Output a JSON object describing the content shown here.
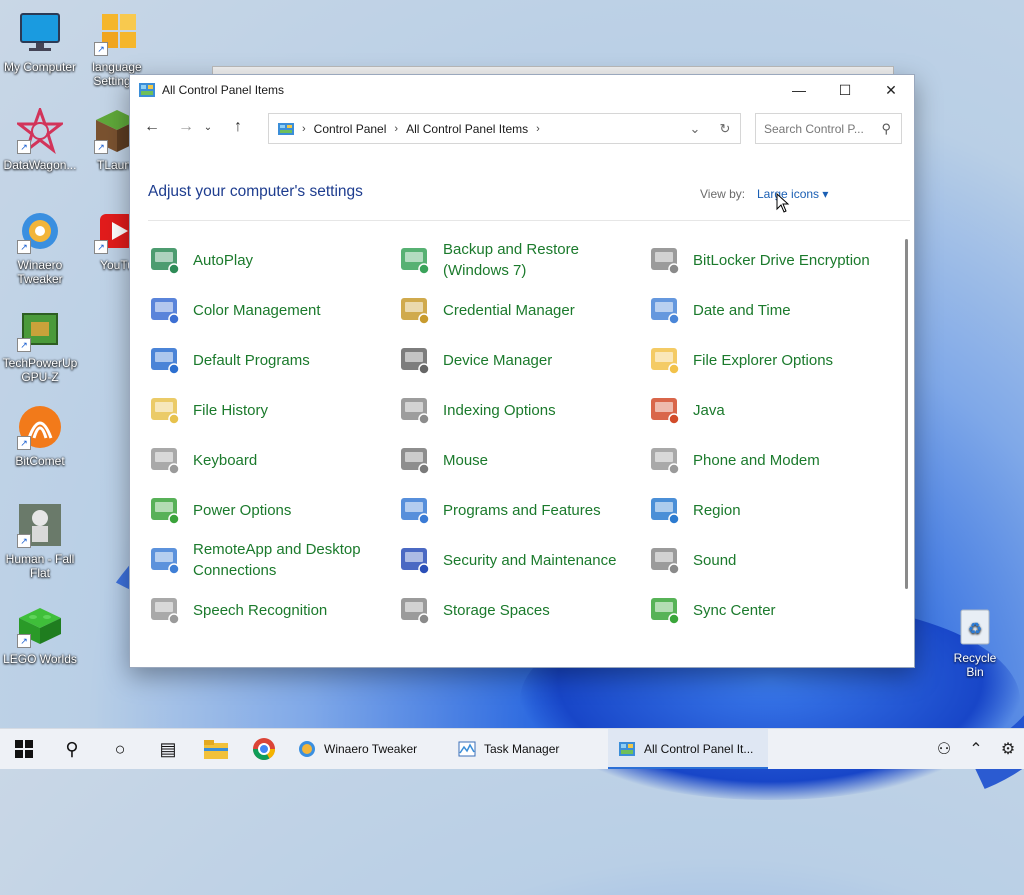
{
  "desktop": {
    "icons": [
      {
        "label": "My Computer"
      },
      {
        "label": "language Setting L"
      },
      {
        "label": "DataWagon..."
      },
      {
        "label": "TLaunc"
      },
      {
        "label": "Winaero Tweaker"
      },
      {
        "label": "YouTu"
      },
      {
        "label": "TechPowerUp GPU-Z"
      },
      {
        "label": "BitComet"
      },
      {
        "label": "Human - Fall Flat"
      },
      {
        "label": "LEGO Worlds"
      }
    ],
    "recycle_bin": "Recycle Bin"
  },
  "window": {
    "title": "All Control Panel Items",
    "controls": {
      "minimize": "—",
      "maximize": "☐",
      "close": "✕"
    },
    "address": {
      "crumbs": [
        "Control Panel",
        "All Control Panel Items"
      ]
    },
    "search": {
      "placeholder": "Search Control P..."
    },
    "heading": "Adjust your computer's settings",
    "view_by_label": "View by:",
    "view_by_value": "Large icons ▾",
    "items": [
      {
        "label": "AutoPlay",
        "icon": "autoplay-icon",
        "color": "#2e8b57"
      },
      {
        "label": "Backup and Restore (Windows 7)",
        "icon": "backup-icon",
        "color": "#3aa35a"
      },
      {
        "label": "BitLocker Drive Encryption",
        "icon": "bitlocker-icon",
        "color": "#8a8a8a"
      },
      {
        "label": "Color Management",
        "icon": "color-management-icon",
        "color": "#3d6fd3"
      },
      {
        "label": "Credential Manager",
        "icon": "credential-manager-icon",
        "color": "#c89b2e"
      },
      {
        "label": "Date and Time",
        "icon": "date-time-icon",
        "color": "#4a86d8"
      },
      {
        "label": "Default Programs",
        "icon": "default-programs-icon",
        "color": "#2c6fd0"
      },
      {
        "label": "Device Manager",
        "icon": "device-manager-icon",
        "color": "#666666"
      },
      {
        "label": "File Explorer Options",
        "icon": "file-explorer-options-icon",
        "color": "#f2c24a"
      },
      {
        "label": "File History",
        "icon": "file-history-icon",
        "color": "#e7c24d"
      },
      {
        "label": "Indexing Options",
        "icon": "indexing-options-icon",
        "color": "#8c8c8c"
      },
      {
        "label": "Java",
        "icon": "java-icon",
        "color": "#d24b2a"
      },
      {
        "label": "Keyboard",
        "icon": "keyboard-icon",
        "color": "#9a9a9a"
      },
      {
        "label": "Mouse",
        "icon": "mouse-icon",
        "color": "#7a7a7a"
      },
      {
        "label": "Phone and Modem",
        "icon": "phone-modem-icon",
        "color": "#9a9a9a"
      },
      {
        "label": "Power Options",
        "icon": "power-options-icon",
        "color": "#3ba33b"
      },
      {
        "label": "Programs and Features",
        "icon": "programs-features-icon",
        "color": "#3a7bd5"
      },
      {
        "label": "Region",
        "icon": "region-icon",
        "color": "#2c7bd0"
      },
      {
        "label": "RemoteApp and Desktop Connections",
        "icon": "remoteapp-icon",
        "color": "#3f7fd6"
      },
      {
        "label": "Security and Maintenance",
        "icon": "security-maintenance-icon",
        "color": "#2b4fb8"
      },
      {
        "label": "Sound",
        "icon": "sound-icon",
        "color": "#8a8a8a"
      },
      {
        "label": "Speech Recognition",
        "icon": "speech-recognition-icon",
        "color": "#9a9a9a"
      },
      {
        "label": "Storage Spaces",
        "icon": "storage-spaces-icon",
        "color": "#8a8a8a"
      },
      {
        "label": "Sync Center",
        "icon": "sync-center-icon",
        "color": "#3aa63a"
      }
    ]
  },
  "taskbar": {
    "apps": [
      {
        "label": "Winaero Tweaker"
      },
      {
        "label": "Task Manager"
      },
      {
        "label": "All Control Panel It..."
      }
    ]
  }
}
